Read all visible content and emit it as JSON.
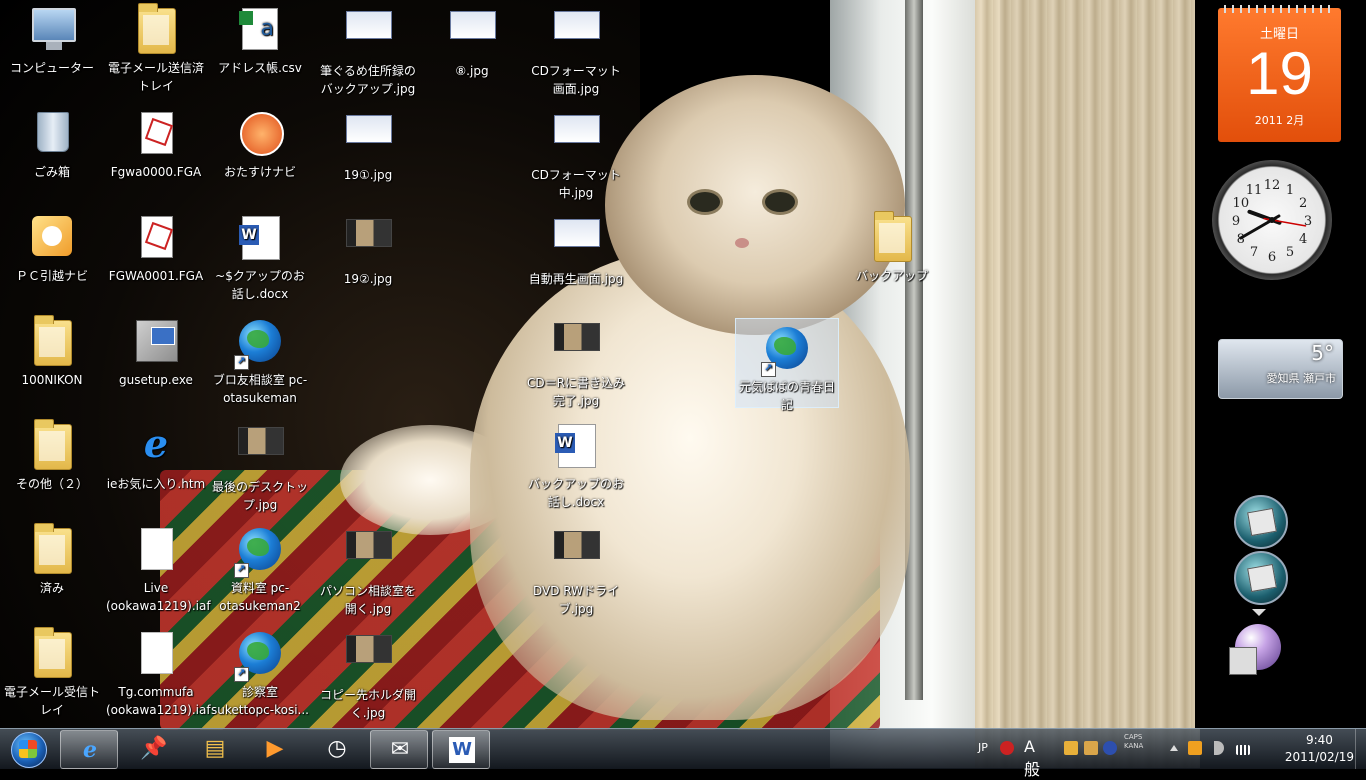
{
  "desktop": {
    "icons": [
      {
        "label": "コンピューター",
        "type": "computer"
      },
      {
        "label": "電子メール送信済トレイ",
        "type": "folder"
      },
      {
        "label": "アドレス帳.csv",
        "type": "excel"
      },
      {
        "label": "筆ぐるめ住所録のバックアップ.jpg",
        "type": "thumb"
      },
      {
        "label": "⑧.jpg",
        "type": "thumb"
      },
      {
        "label": "CDフォーマット画面.jpg",
        "type": "thumb"
      },
      {
        "label": "ごみ箱",
        "type": "trash"
      },
      {
        "label": "Fgwa0000.FGA",
        "type": "fga"
      },
      {
        "label": "おたすけナビ",
        "type": "app"
      },
      {
        "label": "19①.jpg",
        "type": "thumb"
      },
      {
        "label": "CDフォーマット中.jpg",
        "type": "thumb"
      },
      {
        "label": "ＰＣ引越ナビ",
        "type": "pc"
      },
      {
        "label": "FGWA0001.FGA",
        "type": "fga"
      },
      {
        "label": "~$クアップのお話し.docx",
        "type": "word"
      },
      {
        "label": "19②.jpg",
        "type": "thumbdark"
      },
      {
        "label": "自動再生画面.jpg",
        "type": "thumb"
      },
      {
        "label": "バックアップ",
        "type": "folder"
      },
      {
        "label": "100NIKON",
        "type": "folder"
      },
      {
        "label": "gusetup.exe",
        "type": "setup"
      },
      {
        "label": "ブロ友相談室 pc-otasukeman",
        "type": "globe"
      },
      {
        "label": "CD＝Rに書き込み完了.jpg",
        "type": "thumbdark"
      },
      {
        "label": "元気ばばの青春日記",
        "type": "globe"
      },
      {
        "label": "その他（２）",
        "type": "folder"
      },
      {
        "label": "ieお気に入り.htm",
        "type": "ie"
      },
      {
        "label": "最後のデスクトップ.jpg",
        "type": "thumbdark"
      },
      {
        "label": "バックアップのお話し.docx",
        "type": "word"
      },
      {
        "label": "済み",
        "type": "folder"
      },
      {
        "label": "Live (ookawa1219).iaf",
        "type": "blank"
      },
      {
        "label": "資料室 pc-otasukeman2",
        "type": "globe"
      },
      {
        "label": "パソコン相談室を開く.jpg",
        "type": "thumbdark"
      },
      {
        "label": "DVD RWドライブ.jpg",
        "type": "thumbdark"
      },
      {
        "label": "電子メール受信トレイ",
        "type": "folder"
      },
      {
        "label": "Tg.commufa (ookawa1219).iaf",
        "type": "blank"
      },
      {
        "label": "診察室 sukettopc-kosi...",
        "type": "globe"
      },
      {
        "label": "コピー先ホルダ開く.jpg",
        "type": "thumbdark"
      }
    ]
  },
  "gadgets": {
    "calendar": {
      "weekday": "土曜日",
      "day": "19",
      "year_month": "2011 2月"
    },
    "clock": {
      "hour": 9,
      "minute": 40,
      "numbers": [
        "12",
        "1",
        "2",
        "3",
        "4",
        "5",
        "6",
        "7",
        "8",
        "9",
        "10",
        "11"
      ]
    },
    "weather": {
      "temp": "5°",
      "location": "愛知県 瀬戸市"
    }
  },
  "taskbar": {
    "items": [
      {
        "name": "internet-explorer",
        "glyph": "e",
        "active": true
      },
      {
        "name": "pushpin",
        "glyph": "📌",
        "active": false
      },
      {
        "name": "file-explorer",
        "glyph": "▤",
        "active": false
      },
      {
        "name": "media-player",
        "glyph": "▶",
        "active": false
      },
      {
        "name": "clock-app",
        "glyph": "◷",
        "active": false
      },
      {
        "name": "mail",
        "glyph": "✉",
        "active": true
      },
      {
        "name": "word",
        "glyph": "W",
        "active": true
      }
    ],
    "tray": {
      "lang": "JP",
      "ime": "A 般",
      "caps": "CAPS",
      "kana": "KANA",
      "time": "9:40",
      "date": "2011/02/19"
    }
  },
  "colors": {
    "calendar": "#e24f0b",
    "taskbar": "#1a222c",
    "selection": "#c8e1ff"
  }
}
